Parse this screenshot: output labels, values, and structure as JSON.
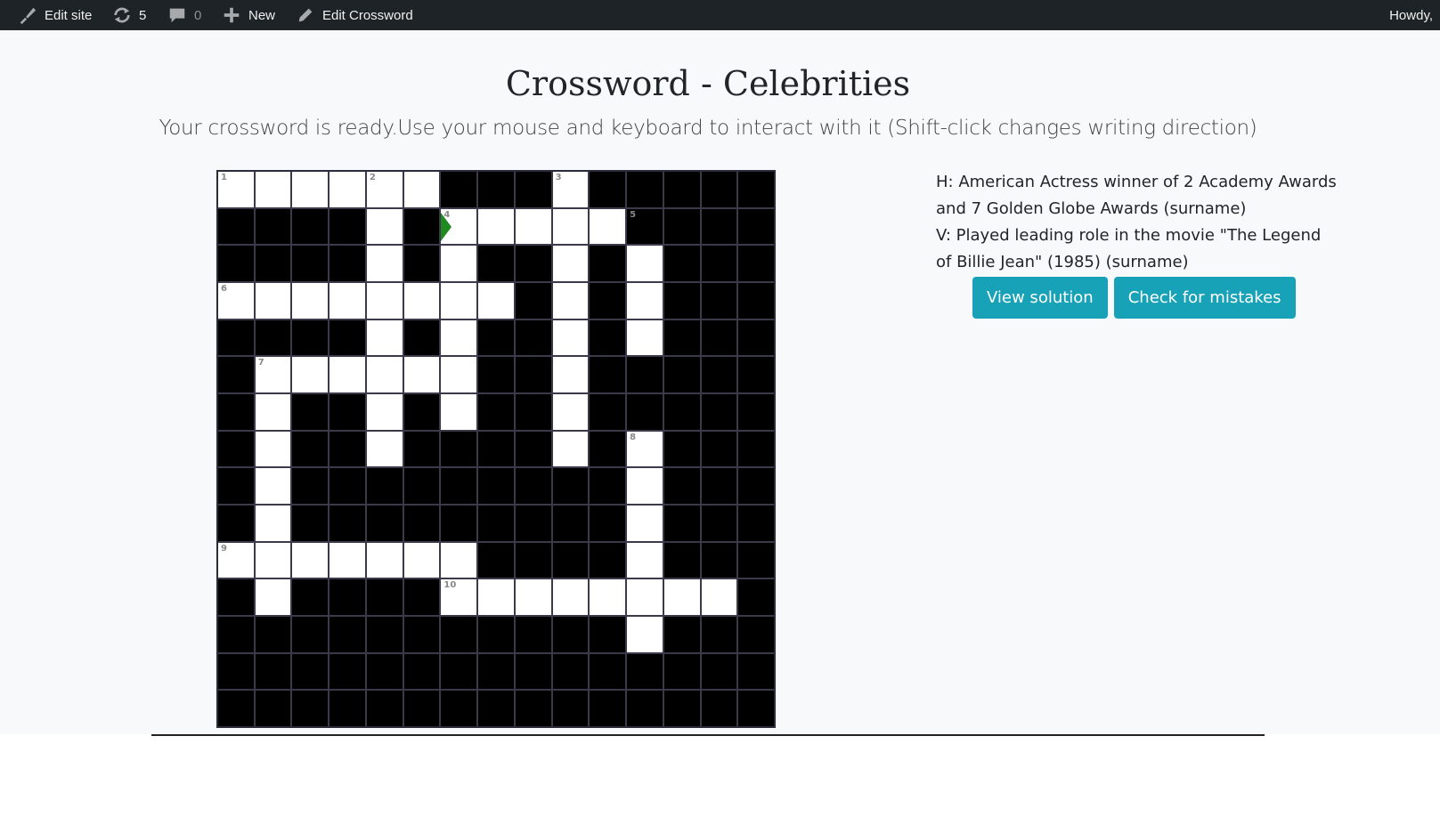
{
  "admin_bar": {
    "edit_site": {
      "icon": "brush-icon",
      "label": "Edit site"
    },
    "updates": {
      "icon": "refresh-icon",
      "count": "5"
    },
    "comments": {
      "icon": "comment-icon",
      "count": "0"
    },
    "new": {
      "icon": "plus-icon",
      "label": "New"
    },
    "edit_crossword": {
      "icon": "pencil-icon",
      "label": "Edit Crossword"
    },
    "howdy": "Howdy,"
  },
  "page": {
    "title": "Crossword - Celebrities",
    "subtitle": "Your crossword is ready.Use your mouse and keyboard to interact with it (Shift-click changes writing direction)"
  },
  "crossword": {
    "size": 15,
    "rows": [
      "WWWWWW...W.....",
      "....W.WWWWW....",
      "....W.W..W.W...",
      "WWWWWWWW.W.W...",
      "....W.W..W.W...",
      ".WWWWWW..W.....",
      ".W..W.W..W.....",
      ".W..W....W.W...",
      ".W.........W...",
      ".W.........W...",
      "WWWWWWW....W...",
      ".W....WWWWWWWW.",
      "...........W...",
      "...............",
      "..............."
    ],
    "numbers": [
      {
        "row": 0,
        "col": 0,
        "n": "1"
      },
      {
        "row": 0,
        "col": 4,
        "n": "2"
      },
      {
        "row": 0,
        "col": 9,
        "n": "3"
      },
      {
        "row": 1,
        "col": 6,
        "n": "4"
      },
      {
        "row": 1,
        "col": 11,
        "n": "5"
      },
      {
        "row": 3,
        "col": 0,
        "n": "6"
      },
      {
        "row": 5,
        "col": 1,
        "n": "7"
      },
      {
        "row": 7,
        "col": 11,
        "n": "8"
      },
      {
        "row": 10,
        "col": 0,
        "n": "9"
      },
      {
        "row": 11,
        "col": 6,
        "n": "10"
      }
    ],
    "active_cell": {
      "row": 1,
      "col": 6,
      "direction": "across",
      "cursor_color": "#1f8a1f"
    }
  },
  "clues": {
    "horizontal": "H: American Actress winner of 2 Academy Awards and 7 Golden Globe Awards (surname)",
    "vertical": "V: Played leading role in the movie \"The Legend of Billie Jean\" (1985) (surname)"
  },
  "buttons": {
    "view_solution": "View solution",
    "check_mistakes": "Check for mistakes"
  },
  "colors": {
    "admin_bar_bg": "#1d2327",
    "button_bg": "#17a2b8",
    "page_bg": "#f8f9fa"
  }
}
